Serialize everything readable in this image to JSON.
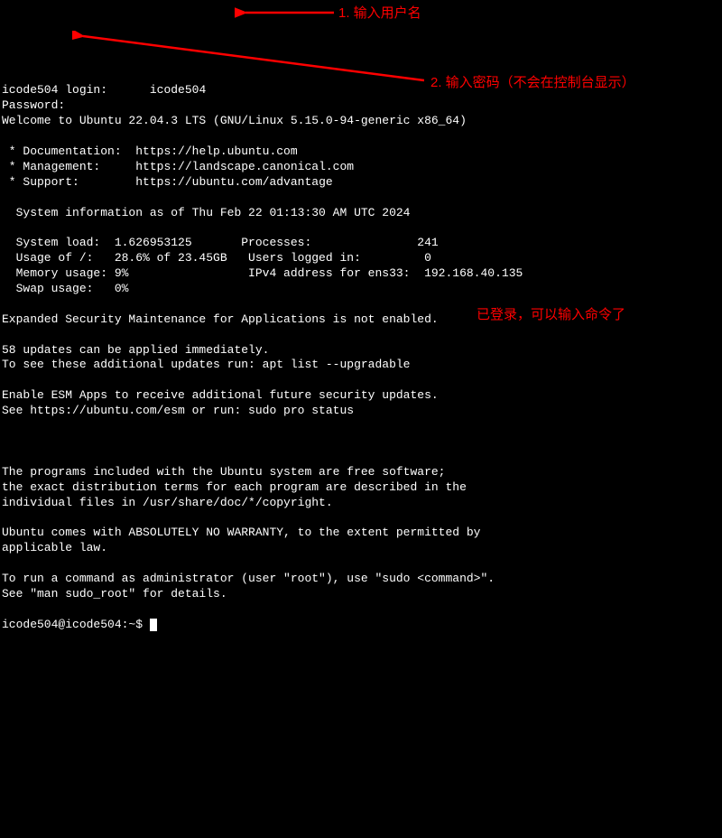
{
  "login": {
    "prompt": "icode504 login:",
    "username": "icode504",
    "password_prompt": "Password:"
  },
  "welcome": "Welcome to Ubuntu 22.04.3 LTS (GNU/Linux 5.15.0-94-generic x86_64)",
  "links": {
    "doc_label": " * Documentation:  ",
    "doc_url": "https://help.ubuntu.com",
    "mgmt_label": " * Management:     ",
    "mgmt_url": "https://landscape.canonical.com",
    "support_label": " * Support:        ",
    "support_url": "https://ubuntu.com/advantage"
  },
  "sysinfo": {
    "header": "  System information as of Thu Feb 22 01:13:30 AM UTC 2024",
    "line1": "  System load:  1.626953125       Processes:               241",
    "line2": "  Usage of /:   28.6% of 23.45GB   Users logged in:         0",
    "line3": "  Memory usage: 9%                 IPv4 address for ens33:  192.168.40.135",
    "line4": "  Swap usage:   0%"
  },
  "esm": {
    "line1": "Expanded Security Maintenance for Applications is not enabled.",
    "updates1": "58 updates can be applied immediately.",
    "updates2": "To see these additional updates run: apt list --upgradable",
    "enable1": "Enable ESM Apps to receive additional future security updates.",
    "enable2": "See https://ubuntu.com/esm or run: sudo pro status"
  },
  "legal": {
    "line1": "The programs included with the Ubuntu system are free software;",
    "line2": "the exact distribution terms for each program are described in the",
    "line3": "individual files in /usr/share/doc/*/copyright.",
    "line4": "Ubuntu comes with ABSOLUTELY NO WARRANTY, to the extent permitted by",
    "line5": "applicable law."
  },
  "sudo": {
    "line1": "To run a command as administrator (user \"root\"), use \"sudo <command>\".",
    "line2": "See \"man sudo_root\" for details."
  },
  "prompt": "icode504@icode504:~$ ",
  "annotations": {
    "a1": "1. 输入用户名",
    "a2": "2. 输入密码（不会在控制台显示）",
    "a3": "已登录，可以输入命令了"
  }
}
